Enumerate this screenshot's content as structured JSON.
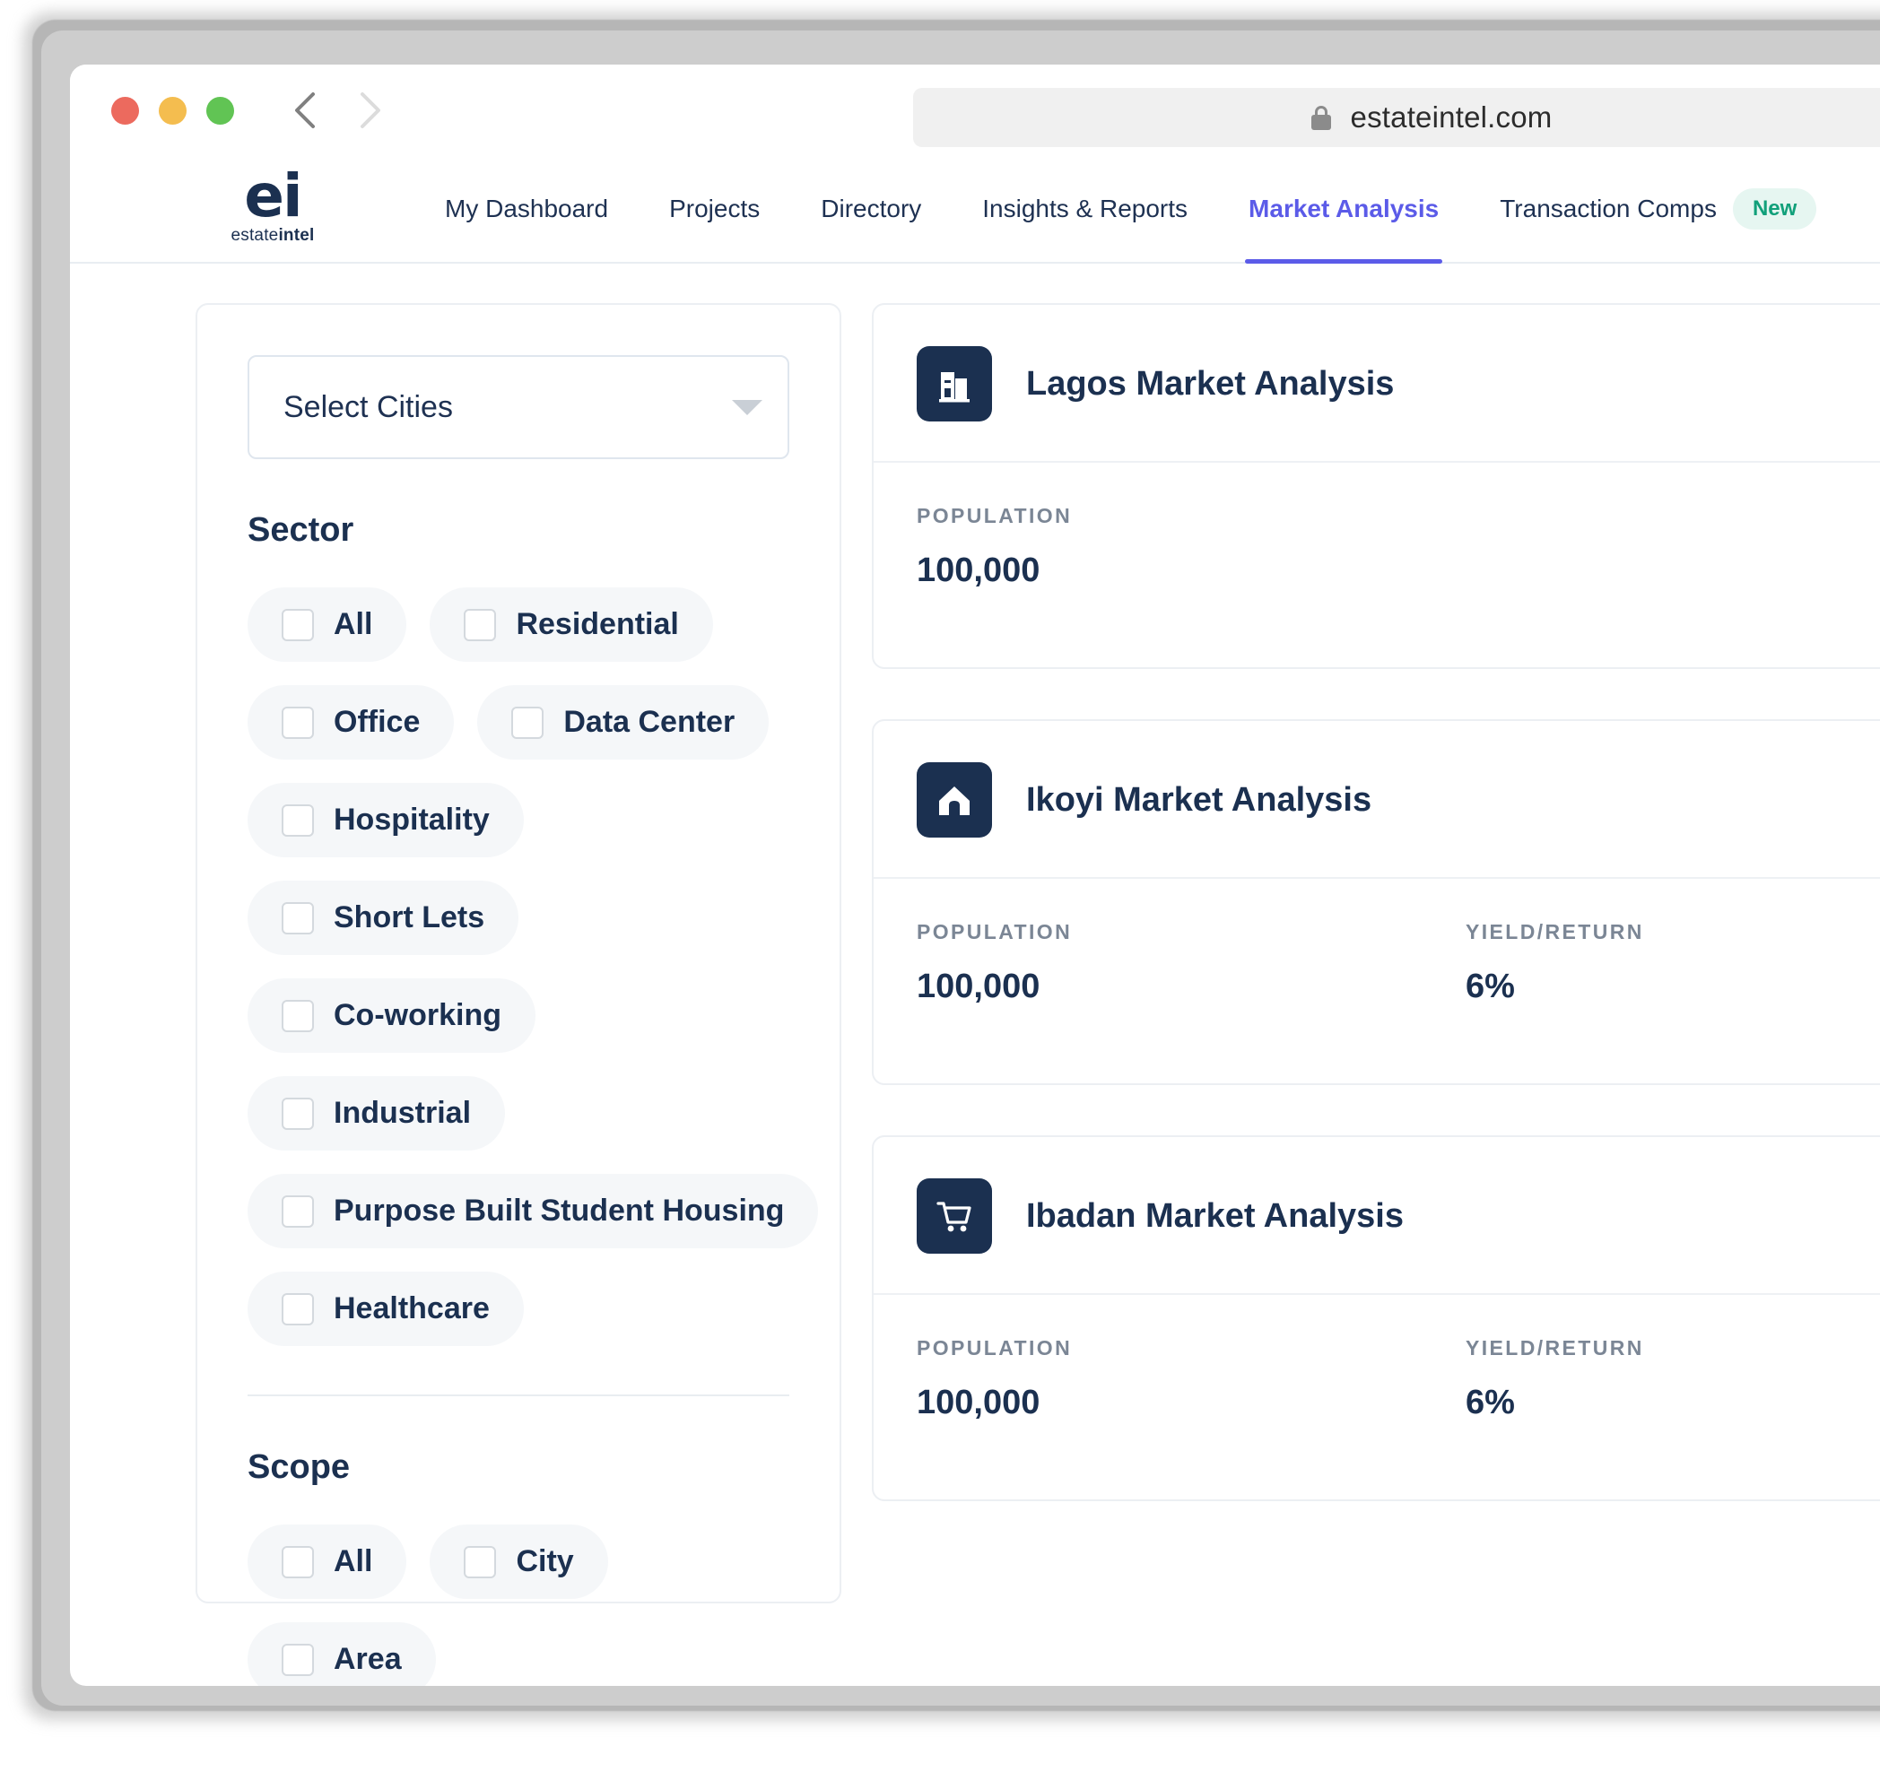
{
  "browser": {
    "url": "estateintel.com",
    "lock_icon": "lock-icon",
    "back_icon": "chevron-left-icon",
    "forward_icon": "chevron-right-icon",
    "traffic_lights": [
      "close-red",
      "minimize-yellow",
      "maximize-green"
    ]
  },
  "header": {
    "logo_mark": "ei",
    "logo_word_light": "estate",
    "logo_word_bold": "intel",
    "nav": [
      {
        "label": "My Dashboard",
        "active": false
      },
      {
        "label": "Projects",
        "active": false
      },
      {
        "label": "Directory",
        "active": false
      },
      {
        "label": "Insights & Reports",
        "active": false
      },
      {
        "label": "Market Analysis",
        "active": true
      },
      {
        "label": "Transaction Comps",
        "active": false,
        "badge": "New"
      }
    ],
    "accent_color": "#5b5be8",
    "badge_color": "#11a07a",
    "badge_bg": "#e6f6f1"
  },
  "sidebar": {
    "city_select": {
      "value": "Select Cities",
      "placeholder": "Select Cities",
      "caret_icon": "chevron-down-icon"
    },
    "sector": {
      "title": "Sector",
      "options": [
        {
          "label": "All",
          "checked": false
        },
        {
          "label": "Residential",
          "checked": false
        },
        {
          "label": "Office",
          "checked": false
        },
        {
          "label": "Data Center",
          "checked": false
        },
        {
          "label": "Hospitality",
          "checked": false
        },
        {
          "label": "Short Lets",
          "checked": false
        },
        {
          "label": "Co-working",
          "checked": false
        },
        {
          "label": "Industrial",
          "checked": false
        },
        {
          "label": "Purpose Built Student Housing",
          "checked": false
        },
        {
          "label": "Healthcare",
          "checked": false
        }
      ]
    },
    "scope": {
      "title": "Scope",
      "options": [
        {
          "label": "All",
          "checked": false
        },
        {
          "label": "City",
          "checked": false
        },
        {
          "label": "Area",
          "checked": false
        }
      ]
    }
  },
  "cards": [
    {
      "title": "Lagos Market Analysis",
      "icon": "city-buildings-icon",
      "metrics": [
        {
          "label": "POPULATION",
          "value": "100,000"
        }
      ]
    },
    {
      "title": "Ikoyi Market Analysis",
      "icon": "house-icon",
      "metrics": [
        {
          "label": "POPULATION",
          "value": "100,000"
        },
        {
          "label": "YIELD/RETURN",
          "value": "6%"
        }
      ]
    },
    {
      "title": "Ibadan Market Analysis",
      "icon": "shopping-cart-icon",
      "metrics": [
        {
          "label": "POPULATION",
          "value": "100,000"
        },
        {
          "label": "YIELD/RETURN",
          "value": "6%"
        }
      ]
    }
  ],
  "colors": {
    "brand_navy": "#1b3050",
    "accent_indigo": "#5b5be8",
    "pill_bg": "#f5f7f9",
    "muted_text": "#7b8695"
  }
}
